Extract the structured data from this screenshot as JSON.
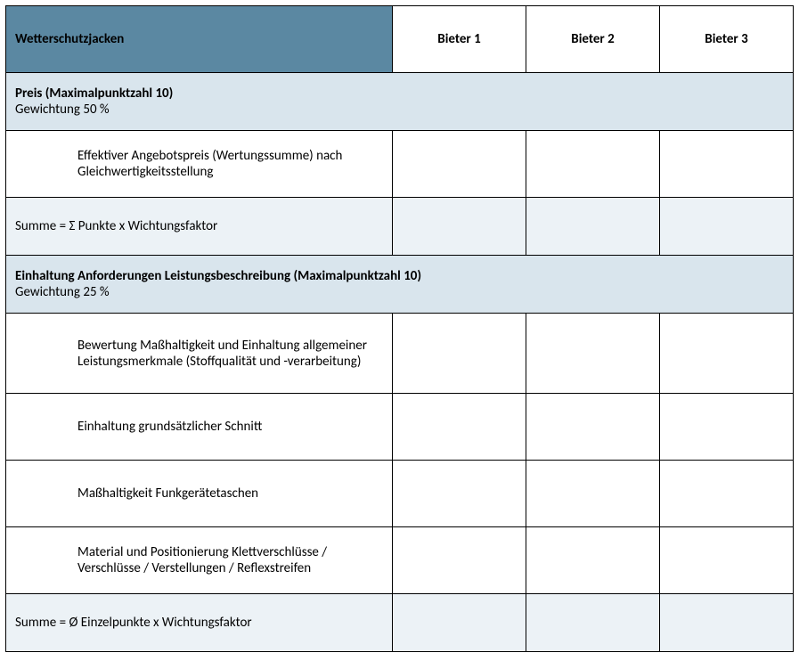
{
  "header": {
    "main_title": "Wetterschutzjacken",
    "bidder1": "Bieter 1",
    "bidder2": "Bieter 2",
    "bidder3": "Bieter 3"
  },
  "section1": {
    "title": "Preis (Maximalpunktzahl 10)",
    "weight": "Gewichtung 50 %",
    "criterion1": "Effektiver Angebotspreis (Wertungssumme) nach Gleichwertigkeitsstellung",
    "summary": "Summe = Σ Punkte x Wichtungsfaktor"
  },
  "section2": {
    "title": "Einhaltung Anforderungen Leistungsbeschreibung (Maximalpunktzahl 10)",
    "weight": "Gewichtung 25 %",
    "criterion1": "Bewertung Maßhaltigkeit und Einhaltung allgemeiner Leistungsmerkmale (Stoffqualität und -verarbeitung)",
    "criterion2": "Einhaltung grundsätzlicher Schnitt",
    "criterion3": "Maßhaltigkeit Funkgerätetaschen",
    "criterion4": "Material und Positionierung Klettverschlüsse / Verschlüsse / Verstellungen / Reflexstreifen",
    "summary": "Summe = Ø Einzelpunkte x Wichtungsfaktor"
  }
}
